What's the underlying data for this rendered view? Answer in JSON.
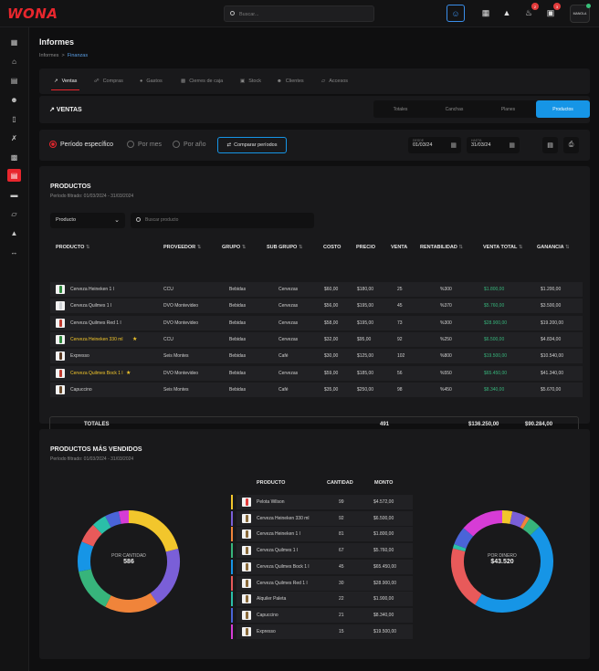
{
  "app": {
    "logo": "WONA",
    "search_placeholder": "Buscar...",
    "avatar": "MANOLA",
    "badges": {
      "bell": "2",
      "card": "3"
    }
  },
  "sidebar": {
    "icons": [
      "dashboard-icon",
      "home-icon",
      "calendar-icon",
      "users-icon",
      "clipboard-icon",
      "tools-icon",
      "reports-icon",
      "card-icon",
      "badge-icon",
      "cap-icon",
      "dumbbell-icon"
    ]
  },
  "page": {
    "title": "Informes",
    "crumb_root": "Informes",
    "crumb_sep": ">",
    "crumb_current": "Finanzas"
  },
  "tabs": [
    "Ventas",
    "Compras",
    "Gastos",
    "Cierres de caja",
    "Stock",
    "Clientes",
    "Accesos"
  ],
  "section": {
    "title": "VENTAS",
    "segments": [
      "Totales",
      "Canchas",
      "Planes",
      "Productos"
    ]
  },
  "filters": {
    "r1": "Período específico",
    "r2": "Por mes",
    "r3": "Por año",
    "compare": "Comparar períodos",
    "from_label": "DESDE",
    "from": "01/03/24",
    "to_label": "HASTA",
    "to": "31/03/24"
  },
  "products": {
    "title": "PRODUCTOS",
    "period": "Período filtrado: 01/03/2024 - 31/03/2024",
    "select": "Producto",
    "search_placeholder": "Buscar producto",
    "headers": [
      "PRODUCTO",
      "PROVEEDOR",
      "GRUPO",
      "SUB GRUPO",
      "COSTO",
      "PRECIO",
      "VENTA",
      "RENTABILIDAD",
      "VENTA TOTAL",
      "GANANCIA"
    ],
    "rows": [
      {
        "name": "Cerveza Heineken 1 l",
        "prov": "CCU",
        "grupo": "Bebidas",
        "sub": "Cervezas",
        "costo": "$60,00",
        "precio": "$180,00",
        "venta": "25",
        "rent": "%300",
        "total": "$1.800,00",
        "gan": "$1.200,00"
      },
      {
        "name": "Cerveza Quilmes 1 l",
        "prov": "DVO Montevideo",
        "grupo": "Bebidas",
        "sub": "Cervezas",
        "costo": "$56,00",
        "precio": "$195,00",
        "venta": "45",
        "rent": "%370",
        "total": "$5.760,00",
        "gan": "$3.500,00"
      },
      {
        "name": "Cerveza Quilmes Red 1 l",
        "prov": "DVO Montevideo",
        "grupo": "Bebidas",
        "sub": "Cervezas",
        "costo": "$58,00",
        "precio": "$195,00",
        "venta": "73",
        "rent": "%300",
        "total": "$28.900,00",
        "gan": "$19.200,00"
      },
      {
        "name": "Cerveza Heineken 330 ml",
        "prov": "CCU",
        "grupo": "Bebidas",
        "sub": "Cervezas",
        "costo": "$32,00",
        "precio": "$95,00",
        "venta": "92",
        "rent": "%250",
        "total": "$6.500,00",
        "gan": "$4.834,00"
      },
      {
        "name": "Expresso",
        "prov": "Seis Montes",
        "grupo": "Bebidas",
        "sub": "Café",
        "costo": "$30,00",
        "precio": "$125,00",
        "venta": "102",
        "rent": "%800",
        "total": "$19.500,00",
        "gan": "$10.540,00"
      },
      {
        "name": "Cerveza Quilmes Bock 1 l",
        "prov": "DVO Montevideo",
        "grupo": "Bebidas",
        "sub": "Cervezas",
        "costo": "$59,00",
        "precio": "$185,00",
        "venta": "56",
        "rent": "%550",
        "total": "$65.450,00",
        "gan": "$41.340,00"
      },
      {
        "name": "Capuccino",
        "prov": "Seis Montes",
        "grupo": "Bebidas",
        "sub": "Café",
        "costo": "$35,00",
        "precio": "$250,00",
        "venta": "98",
        "rent": "%450",
        "total": "$8.340,00",
        "gan": "$5.670,00"
      }
    ],
    "totals": {
      "label": "TOTALES",
      "venta": "491",
      "total": "$136.250,00",
      "gan": "$90.284,00"
    }
  },
  "best": {
    "title": "PRODUCTOS MÁS VENDIDOS",
    "period": "Período filtrado: 01/03/2024 - 31/03/2024",
    "headers": [
      "PRODUCTO",
      "CANTIDAD",
      "MONTO"
    ],
    "rows": [
      {
        "name": "Pelota Wilson",
        "qty": "99",
        "amt": "$4.572,00",
        "color": "#f2c62c"
      },
      {
        "name": "Cerveza Heineken 330 ml",
        "qty": "92",
        "amt": "$6.500,00",
        "color": "#7a5fd8"
      },
      {
        "name": "Cerveza Heineken 1 l",
        "qty": "81",
        "amt": "$1.800,00",
        "color": "#f0843a"
      },
      {
        "name": "Cerveza Quilmes 1 l",
        "qty": "67",
        "amt": "$5.760,00",
        "color": "#37b47b"
      },
      {
        "name": "Cerveza Quilmes Bock 1 l",
        "qty": "45",
        "amt": "$65.450,00",
        "color": "#1695e6"
      },
      {
        "name": "Cerveza Quilmes Red 1 l",
        "qty": "30",
        "amt": "$28.900,00",
        "color": "#e85a5a"
      },
      {
        "name": "Alquiler Paleta",
        "qty": "22",
        "amt": "$1.900,00",
        "color": "#2bbfa8"
      },
      {
        "name": "Capuccino",
        "qty": "21",
        "amt": "$8.340,00",
        "color": "#4a64d8"
      },
      {
        "name": "Expresso",
        "qty": "15",
        "amt": "$19.500,00",
        "color": "#d63cd6"
      }
    ],
    "donut1": {
      "label": "POR CANTIDAD",
      "value": "586"
    },
    "donut2": {
      "label": "POR DINERO",
      "value": "$43.520"
    }
  },
  "chart_data": [
    {
      "type": "pie",
      "title": "POR CANTIDAD",
      "categories": [
        "Pelota Wilson",
        "Cerveza Heineken 330 ml",
        "Cerveza Heineken 1 l",
        "Cerveza Quilmes 1 l",
        "Cerveza Quilmes Bock 1 l",
        "Cerveza Quilmes Red 1 l",
        "Alquiler Paleta",
        "Capuccino",
        "Expresso"
      ],
      "values": [
        99,
        92,
        81,
        67,
        45,
        30,
        22,
        21,
        15
      ]
    },
    {
      "type": "pie",
      "title": "POR DINERO",
      "categories": [
        "Pelota Wilson",
        "Cerveza Heineken 330 ml",
        "Cerveza Heineken 1 l",
        "Cerveza Quilmes 1 l",
        "Cerveza Quilmes Bock 1 l",
        "Cerveza Quilmes Red 1 l",
        "Alquiler Paleta",
        "Capuccino",
        "Expresso"
      ],
      "values": [
        4572,
        6500,
        1800,
        5760,
        65450,
        28900,
        1900,
        8340,
        19500
      ]
    }
  ]
}
